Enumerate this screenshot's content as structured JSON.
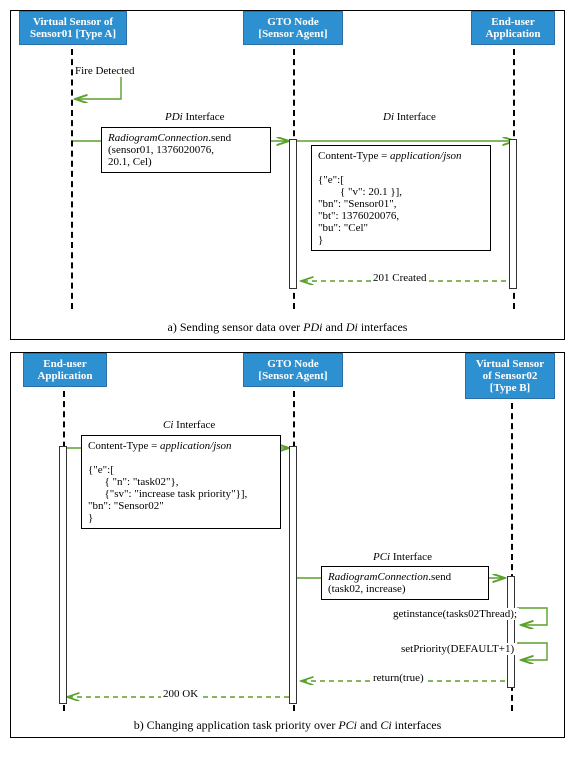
{
  "panelA": {
    "actors": {
      "vs": {
        "line1": "Virtual Sensor of",
        "line2": "Sensor01 [Type A]"
      },
      "gto": {
        "line1": "GTO Node",
        "line2": "[Sensor Agent]"
      },
      "eu": {
        "line1": "End-user",
        "line2": "Application"
      }
    },
    "fireDetected": "Fire Detected",
    "pdiLabel": "PDi Interface",
    "diLabel": "Di Interface",
    "pdiBox": {
      "l1p1": "RadiogramConnection",
      "l1p2": ".send",
      "l2": "(sensor01, 1376020076,",
      "l3": "20.1, Cel)"
    },
    "diBox": {
      "ct1": "Content-Type = ",
      "ct2": "application/json",
      "j1": "{\"e\":[",
      "j2": "        { \"v\": 20.1 }],",
      "j3": " \"bn\": \"Sensor01\",",
      "j4": " \"bt\": 1376020076,",
      "j5": " \"bu\": \"Cel\"",
      "j6": "}"
    },
    "created": "201 Created",
    "caption": "a) Sending sensor data over PDi and Di interfaces"
  },
  "panelB": {
    "actors": {
      "eu": {
        "line1": "End-user",
        "line2": "Application"
      },
      "gto": {
        "line1": "GTO Node",
        "line2": "[Sensor Agent]"
      },
      "vs": {
        "line1": "Virtual Sensor",
        "line2": "of Sensor02",
        "line3": "[Type B]"
      }
    },
    "ciLabel": "Ci Interface",
    "ciBox": {
      "ct1": "Content-Type = ",
      "ct2": "application/json",
      "j1": "{\"e\":[",
      "j2": "      { \"n\": \"task02\"},",
      "j3": "      {\"sv\": \"increase task priority\"}],",
      "j4": " \"bn\": \"Sensor02\"",
      "j5": "}"
    },
    "pciLabel": "PCi Interface",
    "pciBox": {
      "l1p1": "RadiogramConnection",
      "l1p2": ".send",
      "l2": "(task02, increase)"
    },
    "getInst": "getinstance(tasks02Thread);",
    "setPri": "setPriority(DEFAULT+1)",
    "retTrue": "return(true)",
    "ok200": "200 OK",
    "caption": "b) Changing application task priority over PCi and Ci interfaces"
  },
  "chart_data": [
    {
      "type": "sequence-diagram",
      "title": "a) Sending sensor data over PDi and Di interfaces",
      "participants": [
        "Virtual Sensor of Sensor01 [Type A]",
        "GTO Node [Sensor Agent]",
        "End-user Application"
      ],
      "messages": [
        {
          "from": "Virtual Sensor",
          "to": "Virtual Sensor",
          "label": "Fire Detected",
          "type": "self"
        },
        {
          "from": "Virtual Sensor",
          "to": "GTO Node",
          "label": "PDi Interface",
          "payload": "RadiogramConnection.send(sensor01, 1376020076, 20.1, Cel)"
        },
        {
          "from": "GTO Node",
          "to": "End-user Application",
          "label": "Di Interface",
          "payload": "Content-Type=application/json {\"e\":[{\"v\":20.1}],\"bn\":\"Sensor01\",\"bt\":1376020076,\"bu\":\"Cel\"}"
        },
        {
          "from": "End-user Application",
          "to": "GTO Node",
          "label": "201 Created",
          "type": "return"
        }
      ]
    },
    {
      "type": "sequence-diagram",
      "title": "b) Changing application task priority over PCi and Ci interfaces",
      "participants": [
        "End-user Application",
        "GTO Node [Sensor Agent]",
        "Virtual Sensor of Sensor02 [Type B]"
      ],
      "messages": [
        {
          "from": "End-user Application",
          "to": "GTO Node",
          "label": "Ci Interface",
          "payload": "Content-Type=application/json {\"e\":[{\"n\":\"task02\"},{\"sv\":\"increase task priority\"}],\"bn\":\"Sensor02\"}"
        },
        {
          "from": "GTO Node",
          "to": "Virtual Sensor",
          "label": "PCi Interface",
          "payload": "RadiogramConnection.send(task02, increase)"
        },
        {
          "from": "Virtual Sensor",
          "to": "Virtual Sensor",
          "label": "getinstance(tasks02Thread);",
          "type": "self"
        },
        {
          "from": "Virtual Sensor",
          "to": "Virtual Sensor",
          "label": "setPriority(DEFAULT+1)",
          "type": "self"
        },
        {
          "from": "Virtual Sensor",
          "to": "GTO Node",
          "label": "return(true)",
          "type": "return"
        },
        {
          "from": "GTO Node",
          "to": "End-user Application",
          "label": "200 OK",
          "type": "return"
        }
      ]
    }
  ]
}
